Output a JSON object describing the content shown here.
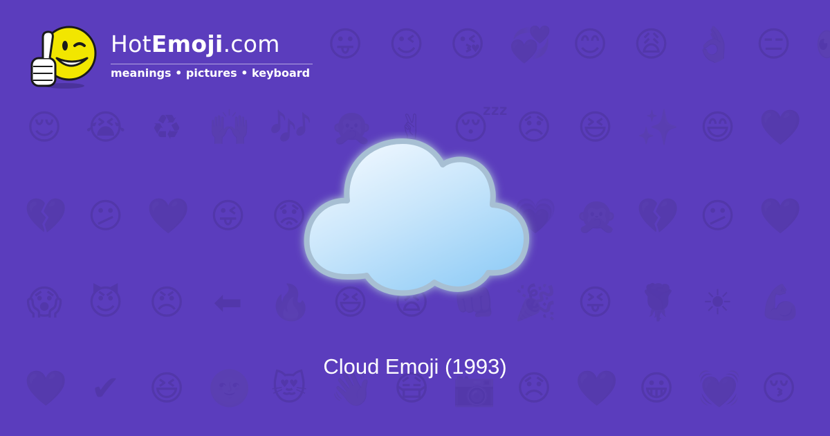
{
  "site": {
    "name_prefix": "Hot",
    "name_bold": "Emoji",
    "name_suffix": ".com",
    "tagline": "meanings • pictures • keyboard"
  },
  "hero": {
    "emoji_icon": "cloud-icon",
    "caption": "Cloud Emoji (1993)"
  },
  "colors": {
    "background": "#5b3dbd",
    "pattern": "#2a1a6a",
    "cloud_fill_light": "#e8f4ff",
    "cloud_fill_dark": "#90cdf7",
    "cloud_outline": "#a9c2d6",
    "text": "#ffffff",
    "mascot_face": "#f2e600"
  },
  "background_pattern": {
    "row1": [
      "😛",
      "😉",
      "😘",
      "💞",
      "😊",
      "😩",
      "👌",
      "😑",
      "👀",
      "😏"
    ],
    "row2": [
      "😌",
      "😭",
      "♻",
      "🙌",
      "🎶",
      "🙊",
      "✌",
      "😴",
      "😞",
      "😆",
      "✨",
      "😄",
      "💜"
    ],
    "row3": [
      "💔",
      "😕",
      "💜",
      "😜",
      "😟",
      "💘",
      "😩",
      "💞",
      "💗",
      "🙊"
    ],
    "row4": [
      "😱",
      "😈",
      "😠",
      "⬅",
      "🔥",
      "😆",
      "😫",
      "👊",
      "🎉",
      "😝",
      "🌹",
      "☀",
      "💪"
    ],
    "row5": [
      "💜",
      "✔",
      "😆",
      "🌝",
      "😻",
      "👋",
      "😷",
      "📷",
      "😞",
      "💜",
      "😀",
      "💓",
      "😚"
    ]
  }
}
